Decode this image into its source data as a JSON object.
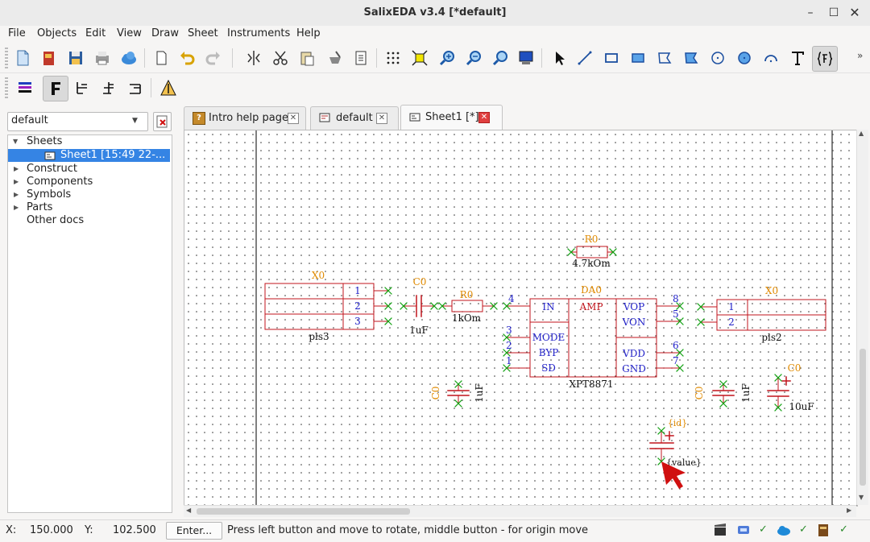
{
  "window": {
    "title": "SalixEDA v3.4 [*default]"
  },
  "menu": [
    "File",
    "Objects",
    "Edit",
    "View",
    "Draw",
    "Sheet",
    "Instruments",
    "Help"
  ],
  "project_combo": {
    "value": "default"
  },
  "tree": {
    "sheets": "Sheets",
    "sheet1": "Sheet1 [15:49 22-...",
    "construct": "Construct",
    "components": "Components",
    "symbols": "Symbols",
    "parts": "Parts",
    "other_docs": "Other docs"
  },
  "tabs": [
    {
      "label": "Intro help page"
    },
    {
      "label": "default"
    },
    {
      "label": "Sheet1 [*]"
    }
  ],
  "schematic": {
    "x0_left": {
      "ref": "X0",
      "name": "pls3",
      "pins": [
        "1",
        "2",
        "3"
      ]
    },
    "c0_series": {
      "ref": "C0",
      "value": "1uF"
    },
    "r0_series": {
      "ref": "R0",
      "value": "1kOm"
    },
    "r0_top": {
      "ref": "R0",
      "value": "4.7kOm"
    },
    "da0": {
      "ref": "DA0",
      "name": "XPT8871",
      "center": "AMP",
      "left_pins": [
        {
          "num": "4",
          "name": "IN"
        },
        {
          "num": "3",
          "name": "MODE"
        },
        {
          "num": "2",
          "name": "BYP"
        },
        {
          "num": "1",
          "name": "SD"
        }
      ],
      "right_pins": [
        {
          "num": "8",
          "name": "VOP"
        },
        {
          "num": "5",
          "name": "VON"
        },
        {
          "num": "6",
          "name": "VDD"
        },
        {
          "num": "7",
          "name": "GND"
        }
      ]
    },
    "x0_right": {
      "ref": "X0",
      "name": "pls2",
      "pins": [
        "1",
        "2"
      ]
    },
    "c0_bottom_left": {
      "ref": "C0",
      "value": "1uF"
    },
    "c0_bottom_mid": {
      "ref": "C0",
      "value": "1uF"
    },
    "c0_bottom_right": {
      "ref": "C0",
      "value": "10uF"
    },
    "cursor_cap": {
      "ref": "{id}",
      "value": "{value}"
    }
  },
  "status": {
    "x_label": "X:",
    "x_value": "150.000",
    "y_label": "Y:",
    "y_value": "102.500",
    "enter_button": "Enter...",
    "message": "Press left button and move to rotate, middle button - for origin move",
    "check": "✓"
  },
  "colors": {
    "wire": "#c0141c",
    "text_blue": "#2222c8",
    "ref_orange": "#e08a00",
    "pin_green": "#10a010",
    "cursor": "#d01010"
  }
}
